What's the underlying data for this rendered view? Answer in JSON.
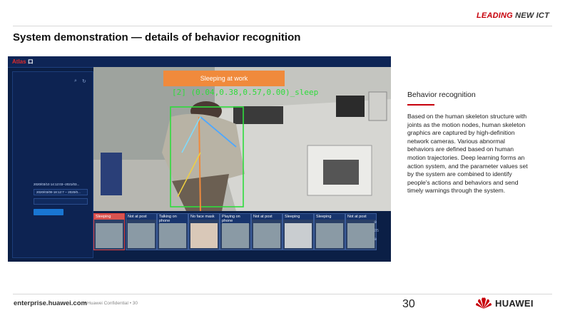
{
  "header": {
    "brand_part1": "LEADING",
    "brand_part2": "NEW ICT",
    "title": "System demonstration — details of behavior recognition"
  },
  "app": {
    "logo_prefix": "Atlas",
    "logo_suffix": "ロ",
    "nav": [
      "",
      "",
      "",
      ""
    ],
    "user": "",
    "sidebar": {
      "tree": [
        "",
        "",
        ""
      ]
    },
    "form": {
      "time_label": "",
      "time_value": "2020/03/10 14:12:03--2021/03...",
      "range_value": "2020/03/09 18:12:7 -- 2020/0...",
      "type_value": "",
      "query_button": ""
    },
    "alert": "Sleeping at work",
    "detection": "[2] (0.04,0.38,0.57,0.00)_sleep",
    "thumbnails": [
      {
        "label": "Sleeping",
        "alert": true
      },
      {
        "label": "Not at post",
        "alert": false
      },
      {
        "label": "Talking on phone",
        "alert": false
      },
      {
        "label": "No face mask",
        "alert": false
      },
      {
        "label": "Playing on phone",
        "alert": false
      },
      {
        "label": "Not at post",
        "alert": false
      },
      {
        "label": "Sleeping",
        "alert": false
      },
      {
        "label": "Sleeping",
        "alert": false
      },
      {
        "label": "Not at post",
        "alert": false
      }
    ],
    "page_indicator": "2/5"
  },
  "content": {
    "heading": "Behavior recognition",
    "body": "Based on the human skeleton structure with joints as the motion nodes, human skeleton graphics are captured by high-definition network cameras. Various abnormal behaviors are defined based on human motion trajectories. Deep learning forms an action system, and the parameter values set by the system are combined to identify people's actions and behaviors and send timely warnings through the system."
  },
  "footer": {
    "site": "enterprise.huawei.com",
    "confidential": "Huawei Confidential",
    "conf_page": "30",
    "page": "30",
    "company": "HUAWEI"
  },
  "colors": {
    "huawei_red": "#c7000b",
    "panel_bg": "#0b1f46",
    "alert_orange": "#f08a3c",
    "detect_green": "#2fdc3c"
  }
}
